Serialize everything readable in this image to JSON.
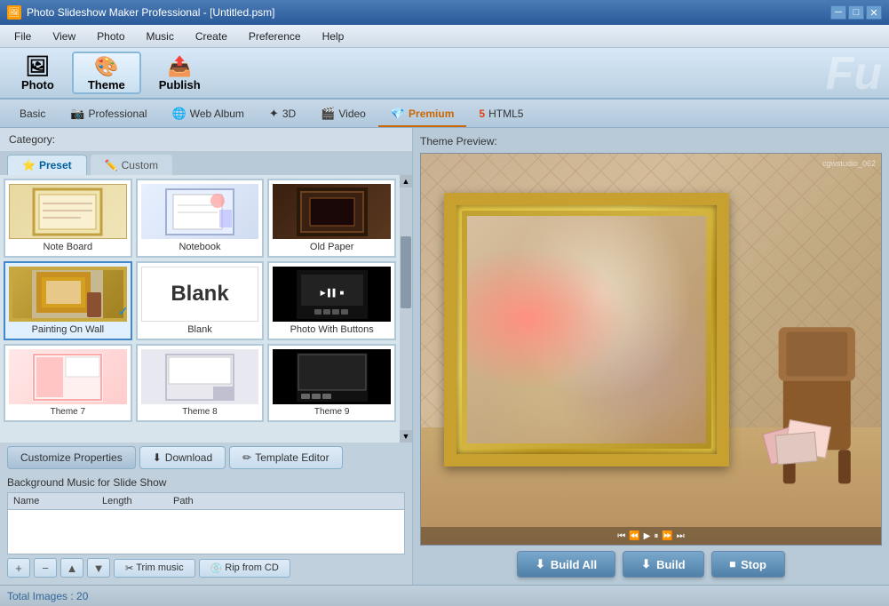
{
  "titlebar": {
    "title": "Photo Slideshow Maker Professional - [Untitled.psm]",
    "controls": [
      "minimize",
      "maximize",
      "close"
    ]
  },
  "menubar": {
    "items": [
      "File",
      "View",
      "Photo",
      "Music",
      "Create",
      "Preference",
      "Help"
    ]
  },
  "toolbar": {
    "photo_label": "Photo",
    "theme_label": "Theme",
    "publish_label": "Publish",
    "bg_text": "Fu"
  },
  "tabs": {
    "items": [
      {
        "label": "Basic",
        "active": false
      },
      {
        "label": "Professional",
        "active": false
      },
      {
        "label": "Web Album",
        "active": false
      },
      {
        "label": "3D",
        "active": false
      },
      {
        "label": "Video",
        "active": false
      },
      {
        "label": "Premium",
        "active": true,
        "color": "#cc6600"
      },
      {
        "label": "HTML5",
        "active": false
      }
    ]
  },
  "left_panel": {
    "category_label": "Category:",
    "preset_tab": "Preset",
    "custom_tab": "Custom",
    "themes": [
      {
        "name": "Note Board",
        "thumb": "noteboard",
        "selected": false
      },
      {
        "name": "Notebook",
        "thumb": "notebook",
        "selected": false
      },
      {
        "name": "Old Paper",
        "thumb": "oldpaper",
        "selected": false
      },
      {
        "name": "Painting On Wall",
        "thumb": "painting",
        "selected": true
      },
      {
        "name": "Blank",
        "thumb": "blank",
        "selected": false
      },
      {
        "name": "Photo With Buttons",
        "thumb": "photobtn",
        "selected": false
      },
      {
        "name": "Theme7",
        "thumb": "r1",
        "selected": false
      },
      {
        "name": "Theme8",
        "thumb": "r2",
        "selected": false
      },
      {
        "name": "Theme9",
        "thumb": "r3",
        "selected": false
      }
    ]
  },
  "action_buttons": {
    "customize": "Customize Properties",
    "download": "Download",
    "template_editor": "Template Editor"
  },
  "music_section": {
    "label": "Background Music for Slide Show",
    "columns": [
      "Name",
      "Length",
      "Path"
    ],
    "trim_label": "Trim music",
    "rip_label": "Rip from CD"
  },
  "right_panel": {
    "preview_label": "Theme Preview:",
    "watermark": "cgwstudio_062"
  },
  "build_buttons": {
    "build_all": "Build All",
    "build": "Build",
    "stop": "Stop"
  },
  "statusbar": {
    "total_images": "Total Images : 20"
  }
}
